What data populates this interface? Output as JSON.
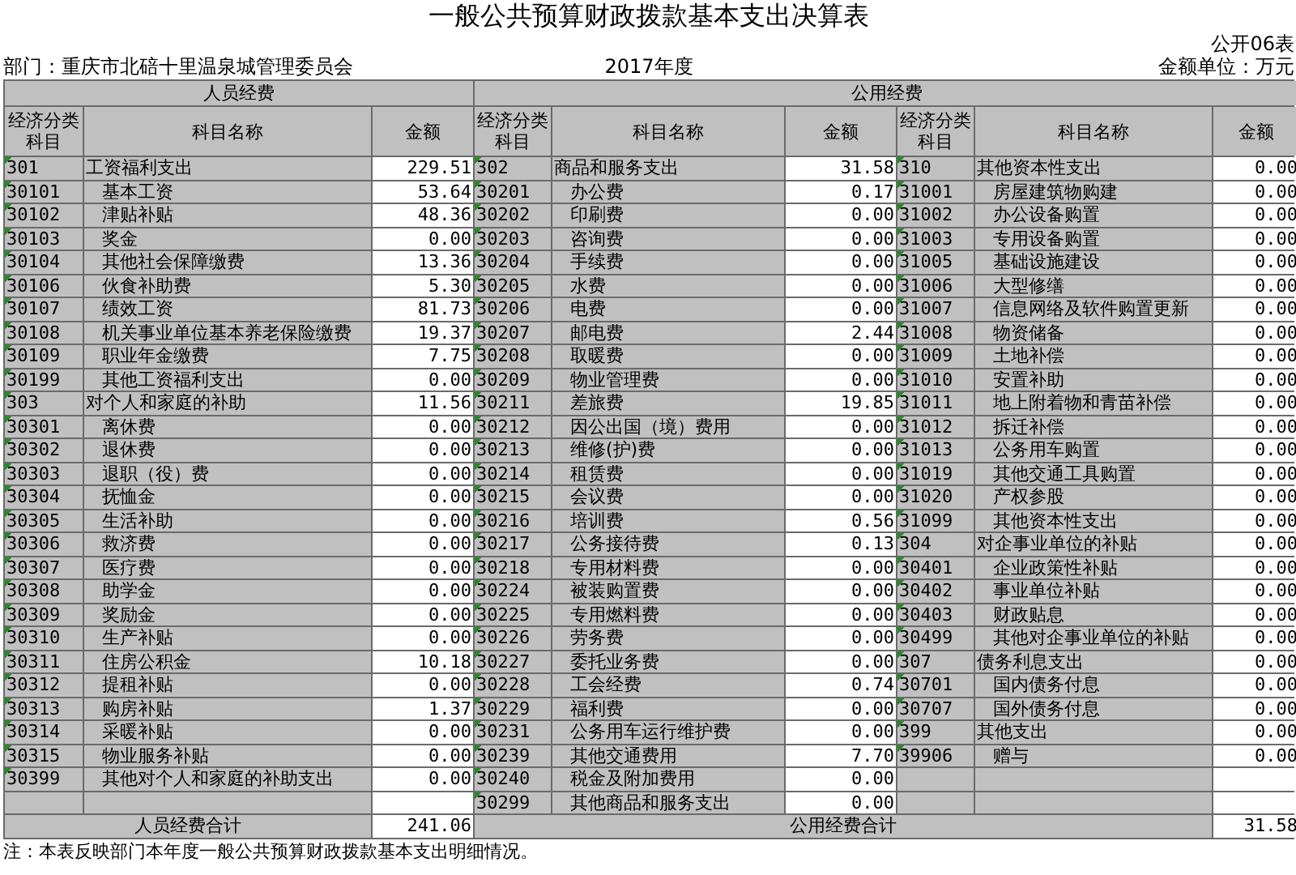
{
  "title": "一般公共预算财政拨款基本支出决算表",
  "table_no": "公开06表",
  "department": "部门：重庆市北碚十里温泉城管理委员会",
  "year": "2017年度",
  "unit": "金额单位：万元",
  "personnel": {
    "heading": "人员经费",
    "columns": [
      "经济分类科目",
      "科目名称",
      "金额"
    ],
    "total_label": "人员经费合计",
    "total": "241.06",
    "items": [
      {
        "code": "301",
        "name": "工资福利支出",
        "amount": "229.51",
        "children": [
          {
            "code": "30101",
            "name": "基本工资",
            "amount": "53.64"
          },
          {
            "code": "30102",
            "name": "津贴补贴",
            "amount": "48.36"
          },
          {
            "code": "30103",
            "name": "奖金",
            "amount": "0.00"
          },
          {
            "code": "30104",
            "name": "其他社会保障缴费",
            "amount": "13.36"
          },
          {
            "code": "30106",
            "name": "伙食补助费",
            "amount": "5.30"
          },
          {
            "code": "30107",
            "name": "绩效工资",
            "amount": "81.73"
          },
          {
            "code": "30108",
            "name": "机关事业单位基本养老保险缴费",
            "amount": "19.37"
          },
          {
            "code": "30109",
            "name": "职业年金缴费",
            "amount": "7.75"
          },
          {
            "code": "30199",
            "name": "其他工资福利支出",
            "amount": "0.00"
          }
        ]
      },
      {
        "code": "303",
        "name": "对个人和家庭的补助",
        "amount": "11.56",
        "children": [
          {
            "code": "30301",
            "name": "离休费",
            "amount": "0.00"
          },
          {
            "code": "30302",
            "name": "退休费",
            "amount": "0.00"
          },
          {
            "code": "30303",
            "name": "退职（役）费",
            "amount": "0.00"
          },
          {
            "code": "30304",
            "name": "抚恤金",
            "amount": "0.00"
          },
          {
            "code": "30305",
            "name": "生活补助",
            "amount": "0.00"
          },
          {
            "code": "30306",
            "name": "救济费",
            "amount": "0.00"
          },
          {
            "code": "30307",
            "name": "医疗费",
            "amount": "0.00"
          },
          {
            "code": "30308",
            "name": "助学金",
            "amount": "0.00"
          },
          {
            "code": "30309",
            "name": "奖励金",
            "amount": "0.00"
          },
          {
            "code": "30310",
            "name": "生产补贴",
            "amount": "0.00"
          },
          {
            "code": "30311",
            "name": "住房公积金",
            "amount": "10.18"
          },
          {
            "code": "30312",
            "name": "提租补贴",
            "amount": "0.00"
          },
          {
            "code": "30313",
            "name": "购房补贴",
            "amount": "1.37"
          },
          {
            "code": "30314",
            "name": "采暖补贴",
            "amount": "0.00"
          },
          {
            "code": "30315",
            "name": "物业服务补贴",
            "amount": "0.00"
          },
          {
            "code": "30399",
            "name": "其他对个人和家庭的补助支出",
            "amount": "0.00"
          }
        ]
      }
    ]
  },
  "public": {
    "heading": "公用经费",
    "columns": [
      "经济分类科目",
      "科目名称",
      "金额",
      "经济分类科目",
      "科目名称",
      "金额"
    ],
    "total_label": "公用经费合计",
    "total": "31.58",
    "groups": [
      [
        {
          "code": "302",
          "name": "商品和服务支出",
          "amount": "31.58",
          "children": [
            {
              "code": "30201",
              "name": "办公费",
              "amount": "0.17"
            },
            {
              "code": "30202",
              "name": "印刷费",
              "amount": "0.00"
            },
            {
              "code": "30203",
              "name": "咨询费",
              "amount": "0.00"
            },
            {
              "code": "30204",
              "name": "手续费",
              "amount": "0.00"
            },
            {
              "code": "30205",
              "name": "水费",
              "amount": "0.00"
            },
            {
              "code": "30206",
              "name": "电费",
              "amount": "0.00"
            },
            {
              "code": "30207",
              "name": "邮电费",
              "amount": "2.44"
            },
            {
              "code": "30208",
              "name": "取暖费",
              "amount": "0.00"
            },
            {
              "code": "30209",
              "name": "物业管理费",
              "amount": "0.00"
            },
            {
              "code": "30211",
              "name": "差旅费",
              "amount": "19.85"
            },
            {
              "code": "30212",
              "name": "因公出国（境）费用",
              "amount": "0.00"
            },
            {
              "code": "30213",
              "name": "维修(护)费",
              "amount": "0.00"
            },
            {
              "code": "30214",
              "name": "租赁费",
              "amount": "0.00"
            },
            {
              "code": "30215",
              "name": "会议费",
              "amount": "0.00"
            },
            {
              "code": "30216",
              "name": "培训费",
              "amount": "0.56"
            },
            {
              "code": "30217",
              "name": "公务接待费",
              "amount": "0.13"
            },
            {
              "code": "30218",
              "name": "专用材料费",
              "amount": "0.00"
            },
            {
              "code": "30224",
              "name": "被装购置费",
              "amount": "0.00"
            },
            {
              "code": "30225",
              "name": "专用燃料费",
              "amount": "0.00"
            },
            {
              "code": "30226",
              "name": "劳务费",
              "amount": "0.00"
            },
            {
              "code": "30227",
              "name": "委托业务费",
              "amount": "0.00"
            },
            {
              "code": "30228",
              "name": "工会经费",
              "amount": "0.74"
            },
            {
              "code": "30229",
              "name": "福利费",
              "amount": "0.00"
            },
            {
              "code": "30231",
              "name": "公务用车运行维护费",
              "amount": "0.00"
            },
            {
              "code": "30239",
              "name": "其他交通费用",
              "amount": "7.70"
            },
            {
              "code": "30240",
              "name": "税金及附加费用",
              "amount": "0.00"
            },
            {
              "code": "30299",
              "name": "其他商品和服务支出",
              "amount": "0.00"
            }
          ]
        }
      ],
      [
        {
          "code": "310",
          "name": "其他资本性支出",
          "amount": "0.00",
          "children": [
            {
              "code": "31001",
              "name": "房屋建筑物购建",
              "amount": "0.00"
            },
            {
              "code": "31002",
              "name": "办公设备购置",
              "amount": "0.00"
            },
            {
              "code": "31003",
              "name": "专用设备购置",
              "amount": "0.00"
            },
            {
              "code": "31005",
              "name": "基础设施建设",
              "amount": "0.00"
            },
            {
              "code": "31006",
              "name": "大型修缮",
              "amount": "0.00"
            },
            {
              "code": "31007",
              "name": "信息网络及软件购置更新",
              "amount": "0.00"
            },
            {
              "code": "31008",
              "name": "物资储备",
              "amount": "0.00"
            },
            {
              "code": "31009",
              "name": "土地补偿",
              "amount": "0.00"
            },
            {
              "code": "31010",
              "name": "安置补助",
              "amount": "0.00"
            },
            {
              "code": "31011",
              "name": "地上附着物和青苗补偿",
              "amount": "0.00"
            },
            {
              "code": "31012",
              "name": "拆迁补偿",
              "amount": "0.00"
            },
            {
              "code": "31013",
              "name": "公务用车购置",
              "amount": "0.00"
            },
            {
              "code": "31019",
              "name": "其他交通工具购置",
              "amount": "0.00"
            },
            {
              "code": "31020",
              "name": "产权参股",
              "amount": "0.00"
            },
            {
              "code": "31099",
              "name": "其他资本性支出",
              "amount": "0.00"
            }
          ]
        },
        {
          "code": "304",
          "name": "对企事业单位的补贴",
          "amount": "0.00",
          "children": [
            {
              "code": "30401",
              "name": "企业政策性补贴",
              "amount": "0.00"
            },
            {
              "code": "30402",
              "name": "事业单位补贴",
              "amount": "0.00"
            },
            {
              "code": "30403",
              "name": "财政贴息",
              "amount": "0.00"
            },
            {
              "code": "30499",
              "name": "其他对企事业单位的补贴",
              "amount": "0.00"
            }
          ]
        },
        {
          "code": "307",
          "name": "债务利息支出",
          "amount": "0.00",
          "children": [
            {
              "code": "30701",
              "name": "国内债务付息",
              "amount": "0.00"
            },
            {
              "code": "30707",
              "name": "国外债务付息",
              "amount": "0.00"
            }
          ]
        },
        {
          "code": "399",
          "name": "其他支出",
          "amount": "0.00",
          "children": [
            {
              "code": "39906",
              "name": "赠与",
              "amount": "0.00"
            }
          ]
        }
      ]
    ]
  },
  "note": "注：本表反映部门本年度一般公共预算财政拨款基本支出明细情况。"
}
